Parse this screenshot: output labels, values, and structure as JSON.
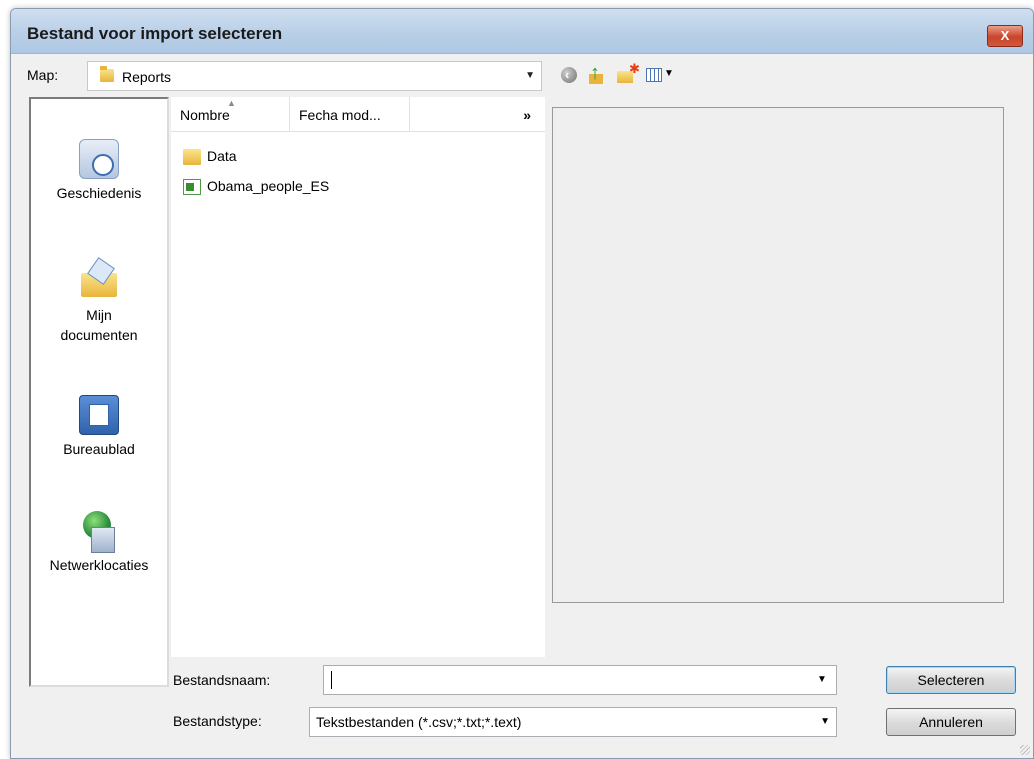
{
  "window": {
    "title": "Bestand voor import selecteren",
    "close_label": "X"
  },
  "toolbar": {
    "map_label": "Map:",
    "location": "Reports",
    "icons": [
      "back-icon",
      "up-folder-icon",
      "new-folder-icon",
      "views-menu-icon"
    ]
  },
  "places": [
    {
      "label": "Geschiedenis",
      "icon": "history-icon"
    },
    {
      "label": "Mijn documenten",
      "icon": "my-documents-icon"
    },
    {
      "label": "Bureaublad",
      "icon": "desktop-icon"
    },
    {
      "label": "Netwerklocaties",
      "icon": "network-places-icon"
    }
  ],
  "filelist": {
    "columns": [
      "Nombre",
      "Fecha mod...",
      "»"
    ],
    "files": [
      {
        "name": "Data",
        "icon": "folder-icon"
      },
      {
        "name": "Obama_people_ES",
        "icon": "excel-file-icon"
      }
    ]
  },
  "form": {
    "filename_label": "Bestandsnaam:",
    "filename_value": "",
    "filetype_label": "Bestandstype:",
    "filetype_value": "Tekstbestanden (*.csv;*.txt;*.text)"
  },
  "buttons": {
    "select": "Selecteren",
    "cancel": "Annuleren"
  }
}
